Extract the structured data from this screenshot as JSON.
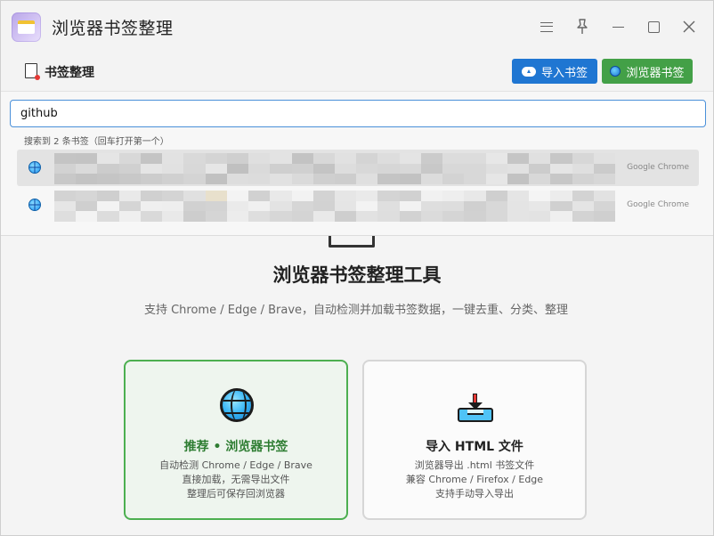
{
  "window": {
    "title": "浏览器书签整理"
  },
  "toolbar": {
    "title": "书签整理",
    "import_label": "导入书签",
    "browser_label": "浏览器书签",
    "import_color": "#1f76d2",
    "browser_color": "#43a047"
  },
  "search": {
    "value": "github",
    "hint": "搜索到 2 条书签（回车打开第一个）",
    "results": [
      {
        "source": "Google Chrome",
        "icon": "globe-icon"
      },
      {
        "source": "Google Chrome",
        "icon": "globe-icon"
      }
    ]
  },
  "main": {
    "title": "浏览器书签整理工具",
    "description": "支持 Chrome / Edge / Brave，自动检测并加载书签数据，一键去重、分类、整理",
    "cards": [
      {
        "title": "推荐 • 浏览器书签",
        "icon": "globe-icon",
        "lines": [
          "自动检测 Chrome / Edge / Brave",
          "直接加载，无需导出文件",
          "整理后可保存回浏览器"
        ]
      },
      {
        "title": "导入 HTML 文件",
        "icon": "import-tray-icon",
        "lines": [
          "浏览器导出 .html 书签文件",
          "兼容 Chrome / Firefox / Edge",
          "支持手动导入导出"
        ]
      }
    ]
  }
}
